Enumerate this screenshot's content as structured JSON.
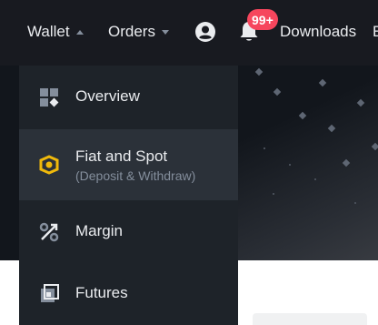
{
  "header": {
    "wallet_label": "Wallet",
    "orders_label": "Orders",
    "downloads_label": "Downloads",
    "cut_label": "E",
    "notification_badge": "99+",
    "icons": {
      "profile": "profile-icon",
      "notifications": "bell-icon"
    }
  },
  "wallet_menu": {
    "items": [
      {
        "label": "Overview",
        "icon": "overview-grid-icon"
      },
      {
        "label": "Fiat and Spot",
        "sublabel": "(Deposit & Withdraw)",
        "icon": "fiat-spot-icon",
        "active": true
      },
      {
        "label": "Margin",
        "icon": "margin-percent-icon"
      },
      {
        "label": "Futures",
        "icon": "futures-icon"
      }
    ]
  },
  "colors": {
    "header_bg": "#181a20",
    "menu_bg": "#1e2329",
    "menu_active_bg": "#2b3139",
    "accent_yellow": "#f0b90b",
    "badge_red": "#f6465d",
    "text_primary": "#eaecef",
    "text_secondary": "#848e9c"
  }
}
